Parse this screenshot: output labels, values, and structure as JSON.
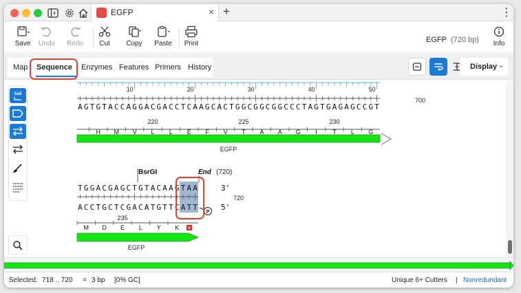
{
  "tab": {
    "title": "EGFP"
  },
  "toolbar": {
    "save": "Save",
    "undo": "Undo",
    "redo": "Redo",
    "cut": "Cut",
    "copy": "Copy",
    "paste": "Paste",
    "print": "Print",
    "info": "Info"
  },
  "seq_info": {
    "name": "EGFP",
    "length": "(720 bp)"
  },
  "view_tabs": [
    "Map",
    "Sequence",
    "Enzymes",
    "Features",
    "Primers",
    "History"
  ],
  "active_tab": "Sequence",
  "display_label": "Display",
  "left_tools": {
    "sall_label": "SalI"
  },
  "block1": {
    "ruler_labels": [
      "10",
      "20",
      "30",
      "40",
      "50"
    ],
    "end_label": "700",
    "sequence": "AGTGTACCAGGACGACCTCAAGCACTGGCGGCGGCCCTAGTGAGAGCCGT",
    "aa_numbers": [
      "220",
      "225",
      "230"
    ],
    "amino_acids": [
      "H",
      "M",
      "V",
      "L",
      "L",
      "E",
      "F",
      "V",
      "T",
      "A",
      "A",
      "G",
      "I",
      "T",
      "L",
      "G"
    ],
    "feature_label": "EGFP"
  },
  "block2": {
    "enzyme": "BsrGI",
    "end_label": "End",
    "end_pos": "(720)",
    "top_seq": "TGGACGAGCTGTACAAGTAA",
    "bottom_seq": "ACCTGCTCGACATGTTCATT",
    "three_prime": "3'",
    "five_prime": "5'",
    "pos_label": "720",
    "aa_number": "235",
    "amino_acids": [
      "M",
      "D",
      "E",
      "L",
      "Y",
      "K"
    ],
    "stop_codon": "×",
    "feature_label": "EGFP"
  },
  "status": {
    "selected_label": "Selected:",
    "range": "718  ..  720",
    "equals": "=",
    "bp": "3 bp",
    "gc": "[0% GC]",
    "cutters": "Unique 6+ Cutters",
    "separator": "|",
    "nonredundant": "Nonredundant"
  },
  "colors": {
    "feature": "#14e614",
    "accent": "#1a7ad4",
    "highlight": "#e2412d",
    "selection": "#8eaac9"
  }
}
